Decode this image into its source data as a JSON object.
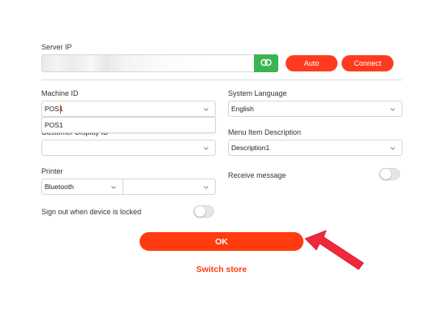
{
  "server": {
    "label": "Server IP",
    "ip_value": "",
    "auto_label": "Auto",
    "connect_label": "Connect"
  },
  "machine": {
    "label": "Machine ID",
    "value": "POS1",
    "dropdown_option": "POS1"
  },
  "customer_display": {
    "label": "Customer Display ID",
    "value": ""
  },
  "printer": {
    "label": "Printer",
    "type_value": "Bluetooth",
    "device_value": ""
  },
  "sign_out": {
    "label": "Sign out when device is locked",
    "enabled": false
  },
  "system_language": {
    "label": "System Language",
    "value": "English"
  },
  "menu_item_description": {
    "label": "Menu Item Description",
    "value": "Description1"
  },
  "receive_message": {
    "label": "Receive message",
    "enabled": false
  },
  "actions": {
    "ok_label": "OK",
    "switch_store_label": "Switch store"
  },
  "colors": {
    "accent": "#ff3b0f",
    "link_button": "#3cb454",
    "toggle_off": "#e6e6e6",
    "arrow": "#f0283c"
  },
  "icons": {
    "link": "link-icon",
    "dropdown": "chevron-down-icon",
    "annotation": "arrow-pointer-icon"
  }
}
